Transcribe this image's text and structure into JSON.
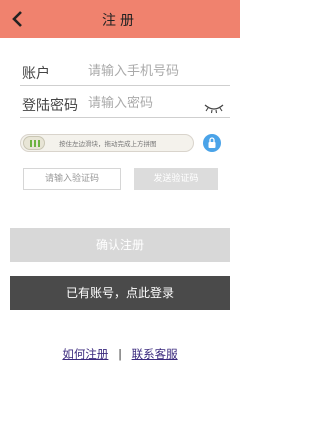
{
  "header": {
    "title": "注册",
    "back_icon": "chevron-left-icon"
  },
  "account": {
    "label": "账户",
    "placeholder": "请输入手机号码"
  },
  "password": {
    "label": "登陆密码",
    "placeholder": "请输入密码",
    "eye_icon": "eye-closed-icon"
  },
  "slider": {
    "text": "按住左边滑块，拖动完成上方拼图",
    "lock_icon": "lock-icon",
    "progress": 0
  },
  "captcha": {
    "placeholder": "请输入验证码",
    "send_label": "发送验证码"
  },
  "buttons": {
    "confirm_label": "确认注册",
    "login_label": "已有账号，点此登录"
  },
  "links": {
    "how_label": "如何注册",
    "separator": "|",
    "service_label": "联系客服"
  },
  "colors": {
    "header": "#f0826e",
    "accent_green": "#6db33f",
    "lock_blue": "#4aa3e8",
    "dark_button": "#4a4a4a",
    "disabled_button": "#d8d8d8"
  }
}
